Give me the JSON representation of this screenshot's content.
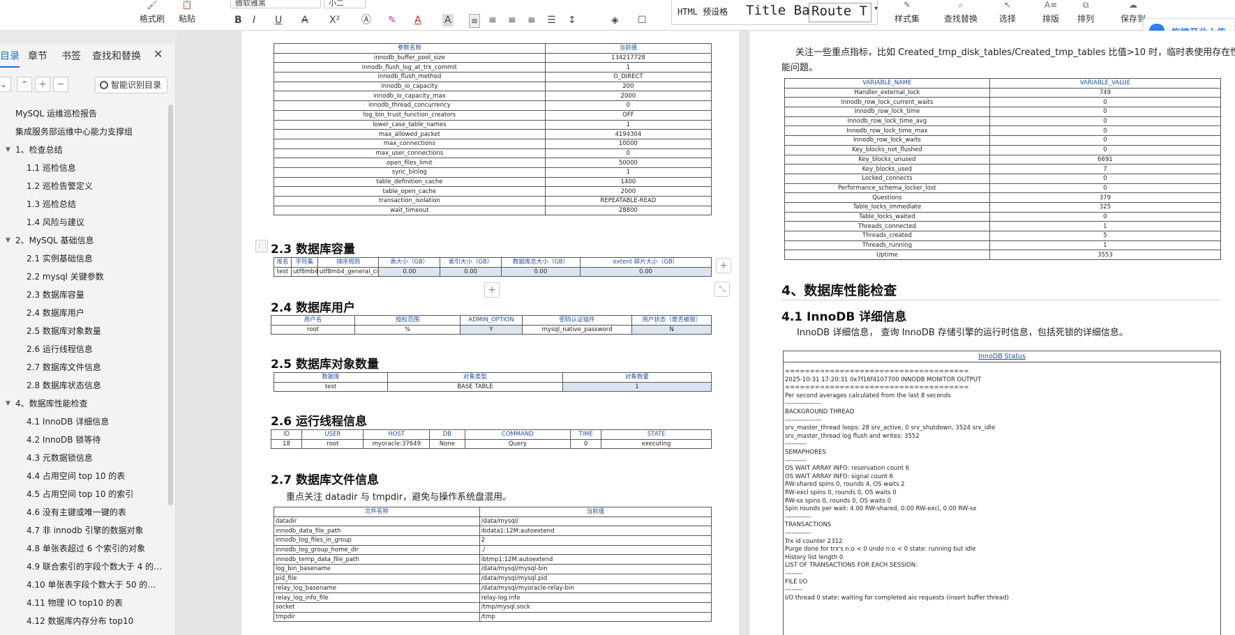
{
  "ribbon": {
    "format_painter": "格式刷",
    "paste": "粘贴",
    "font_name": "微软雅黑",
    "font_size": "小二",
    "style_items": [
      "HTML 预设格",
      "Title Ba",
      "Route T"
    ],
    "style_set": "样式集",
    "find_replace": "查找替换",
    "select": "选择",
    "sort_layout": "排版",
    "arrange": "排列",
    "save": "保存到",
    "cloud_button": "拖拽至此上传",
    "bold": "B",
    "italic": "I",
    "underline": "U",
    "strike": "A",
    "superscript": "X²",
    "font_color": "A"
  },
  "nav": {
    "tabs": [
      "目录",
      "章节",
      "书签",
      "查找和替换"
    ],
    "smart_toc": "智能识别目录",
    "items": [
      {
        "text": "MySQL 运维巡检报告",
        "level": "top"
      },
      {
        "text": "集成服务部运维中心能力支撑组",
        "level": "top"
      },
      {
        "text": "1、检查总结",
        "level": "l1"
      },
      {
        "text": "1.1 巡检信息",
        "level": "l2"
      },
      {
        "text": "1.2 巡检告警定义",
        "level": "l2"
      },
      {
        "text": "1.3 巡检总结",
        "level": "l2"
      },
      {
        "text": "1.4 风险与建议",
        "level": "l2"
      },
      {
        "text": "2、MySQL 基础信息",
        "level": "l1"
      },
      {
        "text": "2.1 实例基础信息",
        "level": "l2"
      },
      {
        "text": "2.2 mysql 关键参数",
        "level": "l2"
      },
      {
        "text": "2.3 数据库容量",
        "level": "l2"
      },
      {
        "text": "2.4 数据库用户",
        "level": "l2"
      },
      {
        "text": "2.5 数据库对象数量",
        "level": "l2"
      },
      {
        "text": "2.6 运行线程信息",
        "level": "l2"
      },
      {
        "text": "2.7 数据库文件信息",
        "level": "l2"
      },
      {
        "text": "2.8 数据库状态信息",
        "level": "l2"
      },
      {
        "text": "4、数据库性能检查",
        "level": "l1"
      },
      {
        "text": "4.1 InnoDB 详细信息",
        "level": "l2"
      },
      {
        "text": "4.2 InnoDB 锁等待",
        "level": "l2"
      },
      {
        "text": "4.3 元数据锁信息",
        "level": "l2"
      },
      {
        "text": "4.4 占用空间 top 10 的表",
        "level": "l2"
      },
      {
        "text": "4.5 占用空间 top 10 的索引",
        "level": "l2"
      },
      {
        "text": "4.6 没有主键或唯一键的表",
        "level": "l2"
      },
      {
        "text": "4.7 非 innodb 引擎的数据对象",
        "level": "l2"
      },
      {
        "text": "4.8 单张表超过 6 个索引的对象",
        "level": "l2"
      },
      {
        "text": "4.9 联合索引的字段个数大于 4 的 ...",
        "level": "l2"
      },
      {
        "text": "4.10 单张表字段个数大于 50 的对 ...",
        "level": "l2"
      },
      {
        "text": "4.11 物理 IO top10 的表",
        "level": "l2"
      },
      {
        "text": "4.12 数据库内存分布 top10",
        "level": "l2"
      }
    ]
  },
  "left_page": {
    "params_table": {
      "headers": [
        "参数名称",
        "当前值"
      ],
      "rows": [
        [
          "innodb_buffer_pool_size",
          "134217728"
        ],
        [
          "innodb_flush_log_at_trx_commit",
          "1"
        ],
        [
          "innodb_flush_method",
          "O_DIRECT"
        ],
        [
          "innodb_io_capacity",
          "200"
        ],
        [
          "innodb_io_capacity_max",
          "2000"
        ],
        [
          "innodb_thread_concurrency",
          "0"
        ],
        [
          "log_bin_trust_function_creators",
          "OFF"
        ],
        [
          "lower_case_table_names",
          "1"
        ],
        [
          "max_allowed_packet",
          "4194304"
        ],
        [
          "max_connections",
          "10000"
        ],
        [
          "max_user_connections",
          "0"
        ],
        [
          "open_files_limit",
          "50000"
        ],
        [
          "sync_binlog",
          "1"
        ],
        [
          "table_definition_cache",
          "1400"
        ],
        [
          "table_open_cache",
          "2000"
        ],
        [
          "transaction_isolation",
          "REPEATABLE-READ"
        ],
        [
          "wait_timeout",
          "28800"
        ]
      ]
    },
    "s23": {
      "title": "2.3 数据库容量",
      "headers": [
        "库名",
        "字符集",
        "排序规则",
        "表大小（GB）",
        "索引大小（GB）",
        "数据库总大小（GB）",
        "extent 碎片大小（GB）"
      ],
      "rows": [
        [
          "test",
          "utf8mb4",
          "utf8mb4_general_ci",
          "0.00",
          "0.00",
          "0.00",
          "0.00"
        ]
      ]
    },
    "s24": {
      "title": "2.4 数据库用户",
      "headers": [
        "用户名",
        "授权范围",
        "ADMIN_OPTION",
        "密码认证插件",
        "用户状态（是否被锁）"
      ],
      "rows": [
        [
          "root",
          "%",
          "Y",
          "mysql_native_password",
          "N"
        ]
      ]
    },
    "s25": {
      "title": "2.5 数据库对象数量",
      "headers": [
        "数据库",
        "对象类型",
        "对象数量"
      ],
      "rows": [
        [
          "test",
          "BASE TABLE",
          "1"
        ]
      ]
    },
    "s26": {
      "title": "2.6 运行线程信息",
      "headers": [
        "ID",
        "USER",
        "HOST",
        "DB",
        "COMMAND",
        "TIME",
        "STATE"
      ],
      "rows": [
        [
          "18",
          "root",
          "myoracle:37649",
          "None",
          "Query",
          "0",
          "executing"
        ]
      ]
    },
    "s27": {
      "title": "2.7 数据库文件信息",
      "intro": "重点关注 datadir 与 tmpdir，避免与操作系统盘混用。",
      "headers": [
        "文件名称",
        "当前值"
      ],
      "rows": [
        [
          "datadir",
          "/data/mysql/"
        ],
        [
          "innodb_data_file_path",
          "ibdata1:12M:autoextend"
        ],
        [
          "innodb_log_files_in_group",
          "2"
        ],
        [
          "innodb_log_group_home_dir",
          "./"
        ],
        [
          "innodb_temp_data_file_path",
          "ibtmp1:12M:autoextend"
        ],
        [
          "log_bin_basename",
          "/data/mysql/mysql-bin"
        ],
        [
          "pid_file",
          "/data/mysql/mysql.pid"
        ],
        [
          "relay_log_basename",
          "/data/mysql/myoracle-relay-bin"
        ],
        [
          "relay_log_info_file",
          "relay-log.info"
        ],
        [
          "socket",
          "/tmp/mysql.sock"
        ],
        [
          "tmpdir",
          "/tmp"
        ]
      ]
    }
  },
  "right_page": {
    "intro": "关注一些重点指标，比如 Created_tmp_disk_tables/Created_tmp_tables 比值>10 时，临时表使用存在性",
    "intro2": "能问题。",
    "status_table": {
      "headers": [
        "VARIABLE_NAME",
        "VARIABLE_VALUE"
      ],
      "rows": [
        [
          "Handler_external_lock",
          "749"
        ],
        [
          "Innodb_row_lock_current_waits",
          "0"
        ],
        [
          "Innodb_row_lock_time",
          "0"
        ],
        [
          "Innodb_row_lock_time_avg",
          "0"
        ],
        [
          "Innodb_row_lock_time_max",
          "0"
        ],
        [
          "Innodb_row_lock_waits",
          "0"
        ],
        [
          "Key_blocks_not_flushed",
          "0"
        ],
        [
          "Key_blocks_unused",
          "6691"
        ],
        [
          "Key_blocks_used",
          "7"
        ],
        [
          "Locked_connects",
          "0"
        ],
        [
          "Performance_schema_locker_lost",
          "0"
        ],
        [
          "Questions",
          "379"
        ],
        [
          "Table_locks_immediate",
          "325"
        ],
        [
          "Table_locks_waited",
          "0"
        ],
        [
          "Threads_connected",
          "1"
        ],
        [
          "Threads_created",
          "5"
        ],
        [
          "Threads_running",
          "1"
        ],
        [
          "Uptime",
          "3553"
        ]
      ]
    },
    "s4_title": "4、数据库性能检查",
    "s41_title": "4.1 InnoDB 详细信息",
    "s41_intro": "InnoDB 详细信息， 查询 InnoDB 存储引擎的运行时信息，包括死锁的详细信息。",
    "innodb_status": {
      "title": "InnoDB Status",
      "lines": [
        "=====================================",
        "2025-10-31 17:20:31 0x7f16f4107700 INNODB MONITOR OUTPUT",
        "=====================================",
        "Per second averages calculated from the last 8 seconds",
        "-----------------",
        "BACKGROUND THREAD",
        "-----------------",
        "srv_master_thread loops: 28 srv_active, 0 srv_shutdown, 3524 srv_idle",
        "srv_master_thread log flush and writes: 3552",
        "----------",
        "SEMAPHORES",
        "----------",
        "OS WAIT ARRAY INFO: reservation count 6",
        "OS WAIT ARRAY INFO: signal count 6",
        "RW-shared spins 0, rounds 4, OS waits 2",
        "RW-excl spins 0, rounds 0, OS waits 0",
        "RW-sx spins 0, rounds 0, OS waits 0",
        "Spin rounds per wait: 4.00 RW-shared, 0.00 RW-excl, 0.00 RW-sx",
        "------------",
        "TRANSACTIONS",
        "------------",
        "Trx id counter 2312",
        "Purge done for trx's n:o < 0 undo n:o < 0 state: running but idle",
        "History list length 0",
        "LIST OF TRANSACTIONS FOR EACH SESSION:",
        "--------",
        "FILE I/O",
        "--------",
        "I/O thread 0 state: waiting for completed aio requests (insert buffer thread)"
      ]
    }
  }
}
